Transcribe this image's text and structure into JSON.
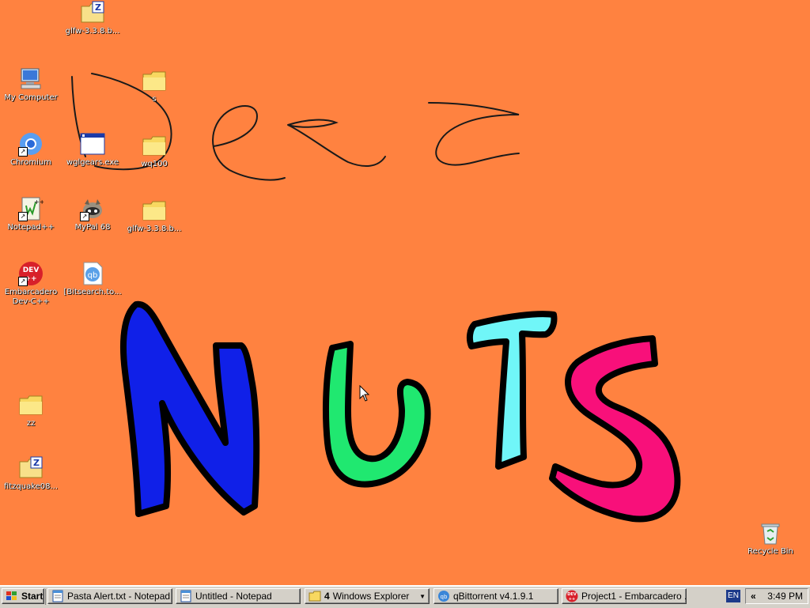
{
  "desktop": {
    "background_color": "#ff8240",
    "wallpaper_words": [
      "Dezz",
      "NUTS"
    ],
    "letter_colors": {
      "N": "#1020e8",
      "U": "#20e870",
      "T": "#70f6f8",
      "S": "#f8107a"
    },
    "icons": [
      {
        "id": "glfw-zip-top",
        "label": "glfw-3.3.8.b...",
        "icon": "zip-folder-icon"
      },
      {
        "id": "my-computer",
        "label": "My Computer",
        "icon": "computer-icon"
      },
      {
        "id": "folder-s",
        "label": "s",
        "icon": "folder-icon"
      },
      {
        "id": "chromium",
        "label": "Chromium",
        "icon": "chromium-icon"
      },
      {
        "id": "wglgears",
        "label": "wglgears.exe",
        "icon": "window-app-icon"
      },
      {
        "id": "wq100",
        "label": "wq100",
        "icon": "folder-icon"
      },
      {
        "id": "notepadpp",
        "label": "Notepad++",
        "icon": "notepad-plus-icon"
      },
      {
        "id": "mypal",
        "label": "MyPal 68",
        "icon": "raccoon-icon"
      },
      {
        "id": "glfw-folder",
        "label": "glfw-3.3.8.b...",
        "icon": "folder-icon"
      },
      {
        "id": "devcpp",
        "label": "Embarcadero Dev-C++",
        "icon": "dev-cpp-icon",
        "badge": "DEV"
      },
      {
        "id": "bitsearch",
        "label": "[Bitsearch.to...",
        "icon": "qbittorrent-file-icon",
        "badge": "qb"
      },
      {
        "id": "zz",
        "label": "zz",
        "icon": "folder-icon"
      },
      {
        "id": "fitzquake",
        "label": "fitzquake08...",
        "icon": "zip-folder-icon"
      },
      {
        "id": "recycle-bin",
        "label": "Recycle Bin",
        "icon": "recycle-bin-icon"
      }
    ]
  },
  "taskbar": {
    "start_label": "Start",
    "buttons": [
      {
        "label": "Pasta Alert.txt - Notepad",
        "icon": "notepad-icon"
      },
      {
        "label": "Untitled - Notepad",
        "icon": "notepad-icon"
      },
      {
        "count": "4",
        "label": "Windows Explorer",
        "icon": "folder-icon"
      },
      {
        "label": "qBittorrent v4.1.9.1",
        "icon": "qbittorrent-icon"
      },
      {
        "label": "Project1 - Embarcadero ...",
        "icon": "dev-cpp-icon"
      }
    ],
    "language": "EN",
    "tray_expand": "«",
    "clock": "3:49 PM"
  }
}
